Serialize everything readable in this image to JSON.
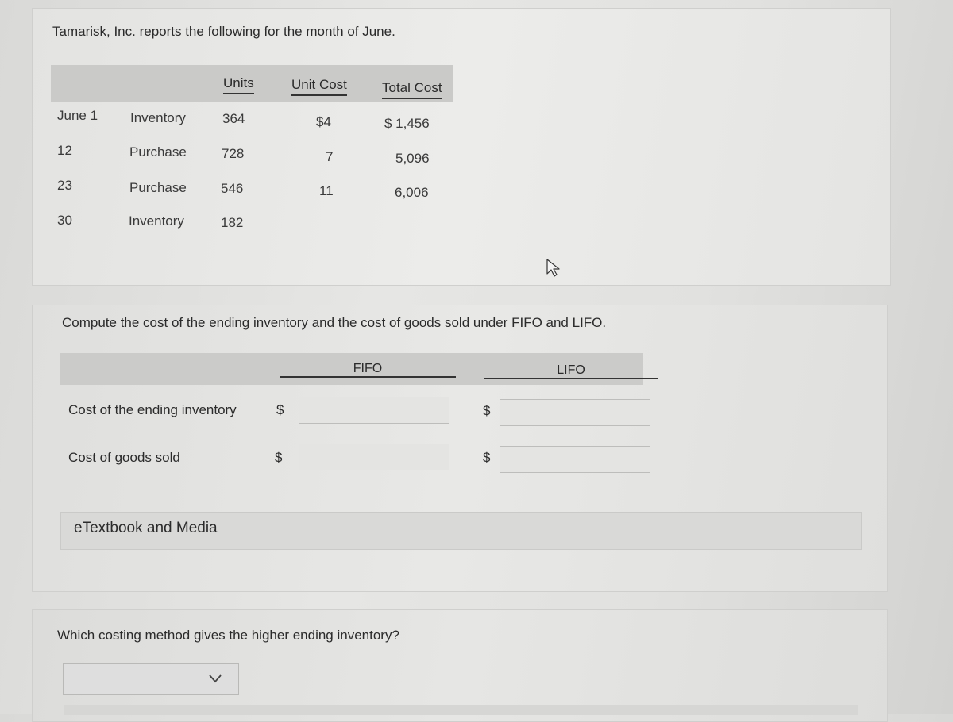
{
  "intro": "Tamarisk, Inc. reports the following for the month of June.",
  "table": {
    "headers": {
      "units": "Units",
      "unit_cost": "Unit Cost",
      "total_cost": "Total Cost"
    },
    "rows": [
      {
        "date": "June 1",
        "type": "Inventory",
        "units": "364",
        "unit_cost": "$4",
        "total_cost": "$ 1,456"
      },
      {
        "date": "12",
        "type": "Purchase",
        "units": "728",
        "unit_cost": "7",
        "total_cost": "5,096"
      },
      {
        "date": "23",
        "type": "Purchase",
        "units": "546",
        "unit_cost": "11",
        "total_cost": "6,006"
      },
      {
        "date": "30",
        "type": "Inventory",
        "units": "182",
        "unit_cost": "",
        "total_cost": ""
      }
    ]
  },
  "compute": {
    "instruction": "Compute the cost of the ending inventory and the cost of goods sold under FIFO and LIFO.",
    "columns": {
      "fifo": "FIFO",
      "lifo": "LIFO"
    },
    "currency_symbol": "$",
    "rows": [
      {
        "label": "Cost of the ending inventory",
        "fifo_value": "",
        "lifo_value": ""
      },
      {
        "label": "Cost of goods sold",
        "fifo_value": "",
        "lifo_value": ""
      }
    ]
  },
  "media": {
    "label": "eTextbook and Media"
  },
  "question": {
    "text": "Which costing method gives the higher ending inventory?",
    "selected": ""
  }
}
